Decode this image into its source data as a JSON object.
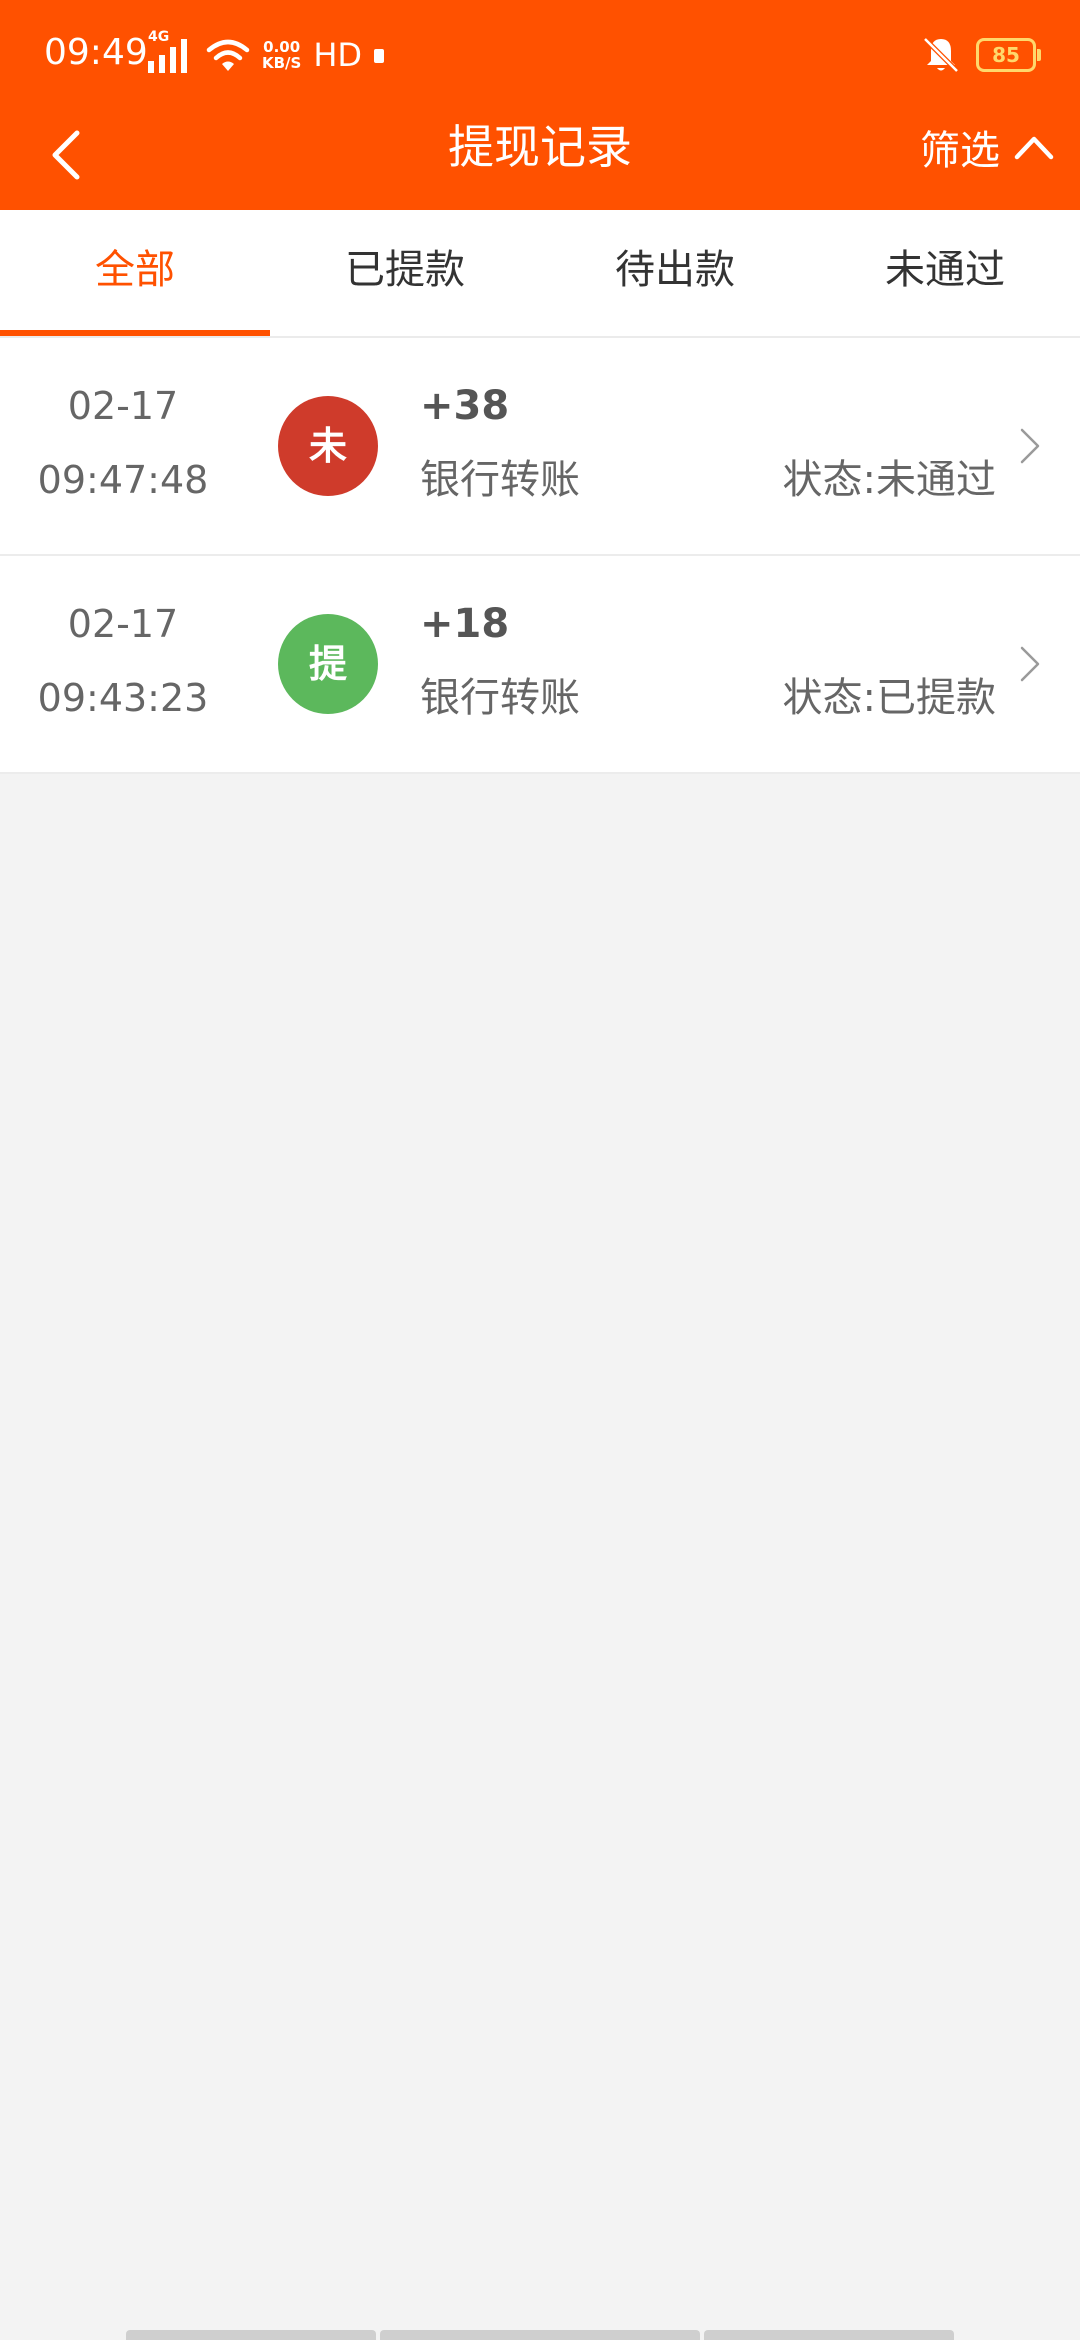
{
  "status_bar": {
    "time": "09:49",
    "network_type": "4G",
    "net_speed_value": "0.00",
    "net_speed_unit": "KB/S",
    "hd_label": "HD",
    "battery_level": "85",
    "icons": [
      "signal-icon",
      "wifi-icon",
      "mute-icon",
      "battery-icon"
    ]
  },
  "app_bar": {
    "title": "提现记录",
    "filter_label": "筛选",
    "back_icon": "chevron-left-icon",
    "filter_icon": "chevron-up-icon"
  },
  "tabs": [
    {
      "label": "全部",
      "active": true
    },
    {
      "label": "已提款",
      "active": false
    },
    {
      "label": "待出款",
      "active": false
    },
    {
      "label": "未通过",
      "active": false
    }
  ],
  "records": [
    {
      "date": "02-17",
      "time": "09:47:48",
      "badge_text": "未",
      "badge_color": "#cf3b2b",
      "amount": "+38",
      "method": "银行转账",
      "status": "状态:未通过"
    },
    {
      "date": "02-17",
      "time": "09:43:23",
      "badge_text": "提",
      "badge_color": "#5cb85c",
      "amount": "+18",
      "method": "银行转账",
      "status": "状态:已提款"
    }
  ],
  "colors": {
    "brand": "#ff5100",
    "background": "#f3f3f3",
    "text_primary": "#333333",
    "text_secondary": "#666666"
  }
}
